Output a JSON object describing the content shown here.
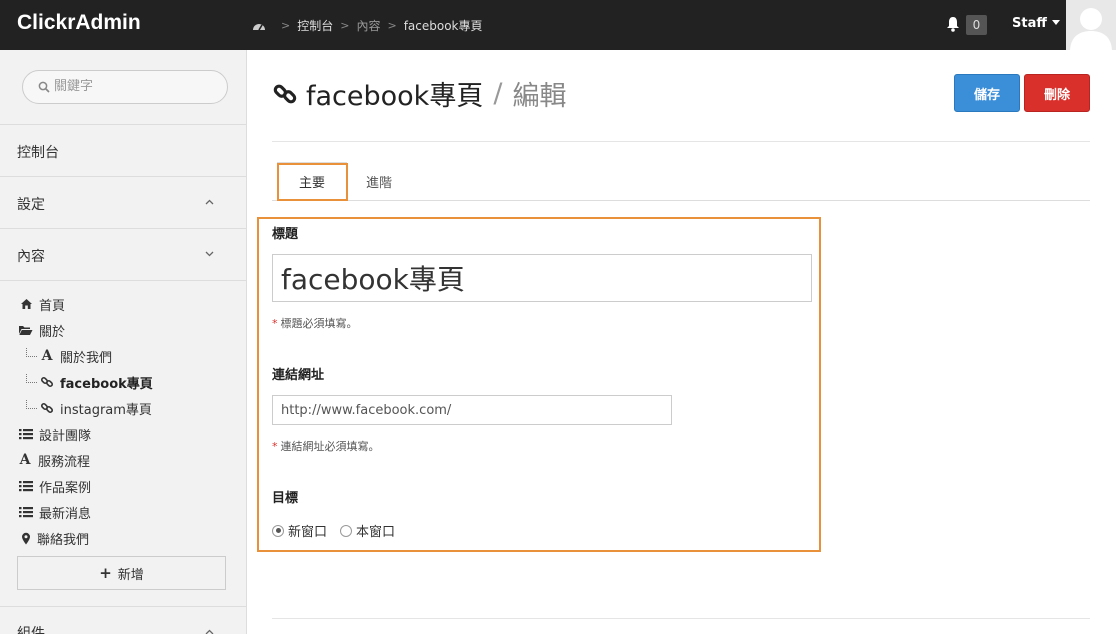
{
  "app": {
    "brand": "ClickrAdmin"
  },
  "breadcrumb": {
    "items": [
      "控制台",
      "內容",
      "facebook專頁"
    ]
  },
  "header": {
    "notification_count": "0",
    "user_label": "Staff"
  },
  "sidebar": {
    "search_placeholder": "關鍵字",
    "sections": {
      "dashboard": "控制台",
      "settings": "設定",
      "content": "內容",
      "components": "組件"
    },
    "tree": [
      {
        "label": "首頁",
        "icon": "home-icon"
      },
      {
        "label": "關於",
        "icon": "folder-open-icon"
      },
      {
        "label": "關於我們",
        "icon": "text-a-icon"
      },
      {
        "label": "facebook專頁",
        "icon": "link-icon",
        "active": true
      },
      {
        "label": "instagram專頁",
        "icon": "link-icon"
      },
      {
        "label": "設計團隊",
        "icon": "list-icon"
      },
      {
        "label": "服務流程",
        "icon": "text-a-icon"
      },
      {
        "label": "作品案例",
        "icon": "list-icon"
      },
      {
        "label": "最新消息",
        "icon": "list-icon"
      },
      {
        "label": "聯絡我們",
        "icon": "map-marker-icon"
      }
    ],
    "add_label": "新增"
  },
  "page": {
    "title": "facebook專頁",
    "subtitle": "編輯",
    "save_label": "儲存",
    "delete_label": "刪除",
    "tabs": [
      "主要",
      "進階"
    ]
  },
  "form": {
    "title_label": "標題",
    "title_value": "facebook專頁",
    "title_help": "標題必須填寫。",
    "url_label": "連結網址",
    "url_value": "http://www.facebook.com/",
    "url_help": "連結網址必須填寫。",
    "target_label": "目標",
    "target_options": [
      "新窗口",
      "本窗口"
    ],
    "target_selected": "新窗口"
  },
  "colors": {
    "topbar": "#222222",
    "save": "#3b8ed8",
    "delete": "#d9302b",
    "highlight": "#e8913a"
  }
}
